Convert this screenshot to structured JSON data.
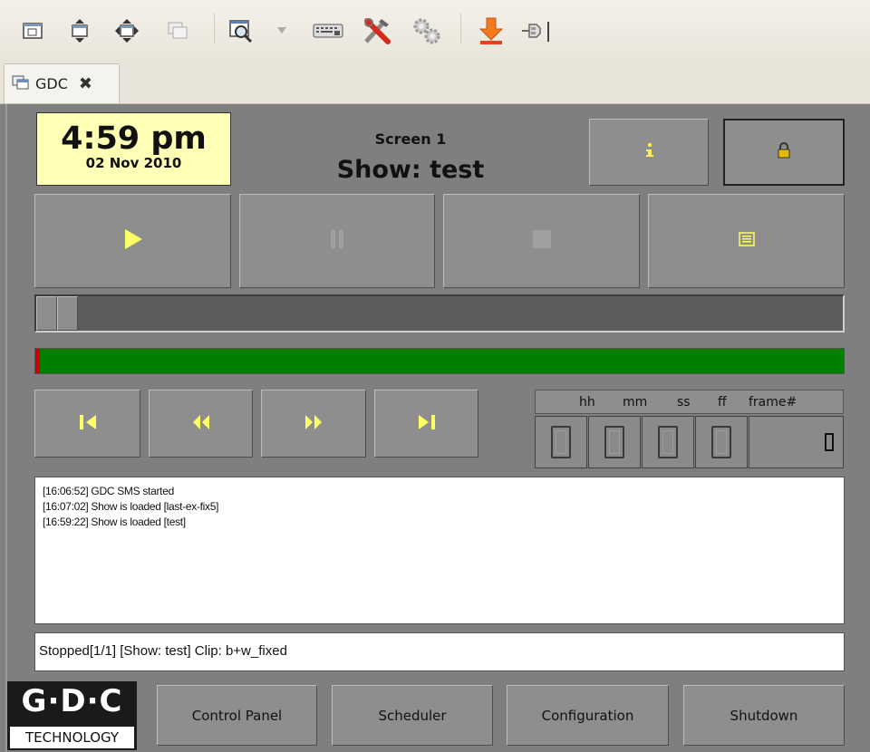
{
  "toolbar": {
    "icons": [
      "window-fit-icon",
      "window-vertical-icon",
      "window-move-icon",
      "window-stack-icon",
      "zoom-window-icon",
      "dropdown-arrow-icon",
      "keyboard-icon",
      "tools-icon",
      "gears-icon",
      "download-icon",
      "connect-plug-icon"
    ]
  },
  "tab": {
    "label": "GDC",
    "close": "✖"
  },
  "clock": {
    "time": "4:59 pm",
    "date": "02 Nov 2010"
  },
  "header": {
    "screen": "Screen 1",
    "show": "Show: test"
  },
  "buttons": {
    "info": "info-icon",
    "lock": "lock-icon",
    "transport": [
      "play-icon",
      "pause-icon",
      "stop-icon",
      "playlist-icon"
    ],
    "seek": [
      "skip-start-icon",
      "rewind-icon",
      "fast-forward-icon",
      "skip-end-icon"
    ]
  },
  "seek_position": 0,
  "progress": {
    "fraction": 0.006,
    "fill_color": "#cc0000",
    "track_color": "#008000"
  },
  "timecode": {
    "headers": {
      "hh": "hh",
      "mm": "mm",
      "ss": "ss",
      "ff": "ff",
      "frame": "frame#"
    },
    "values": {
      "hh": "0",
      "mm": "0",
      "ss": "0",
      "ff": "0",
      "frame": "0"
    }
  },
  "log": {
    "lines": [
      "[16:06:52] GDC SMS started",
      "[16:07:02] Show is loaded [last-ex-fix5]",
      "[16:59:22] Show is loaded [test]"
    ]
  },
  "status": "Stopped[1/1] [Show: test] Clip: b+w_fixed",
  "logo": {
    "top": "G·D·C",
    "bottom": "TECHNOLOGY"
  },
  "nav": {
    "control_panel": "Control Panel",
    "scheduler": "Scheduler",
    "configuration": "Configuration",
    "shutdown": "Shutdown"
  }
}
